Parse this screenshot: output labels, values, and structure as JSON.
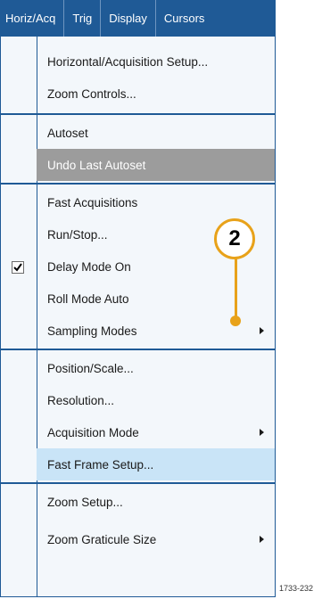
{
  "menubar": {
    "items": [
      "Horiz/Acq",
      "Trig",
      "Display",
      "Cursors"
    ]
  },
  "menu": {
    "group1": [
      "Horizontal/Acquisition Setup...",
      "Zoom Controls..."
    ],
    "group2": [
      "Autoset",
      "Undo Last Autoset"
    ],
    "group3": [
      "Fast Acquisitions",
      "Run/Stop...",
      "Delay Mode On",
      "Roll Mode Auto",
      "Sampling Modes"
    ],
    "group4": [
      "Position/Scale...",
      "Resolution...",
      "Acquisition Mode",
      "Fast Frame Setup..."
    ],
    "group5": [
      "Zoom Setup...",
      "Zoom Graticule Size"
    ]
  },
  "callout": {
    "number": "2"
  },
  "figure_label": "1733-232",
  "colors": {
    "menubar": "#1f5a96",
    "highlight": "#c9e4f7",
    "disabled": "#9c9c9c",
    "callout": "#e8a21a"
  }
}
